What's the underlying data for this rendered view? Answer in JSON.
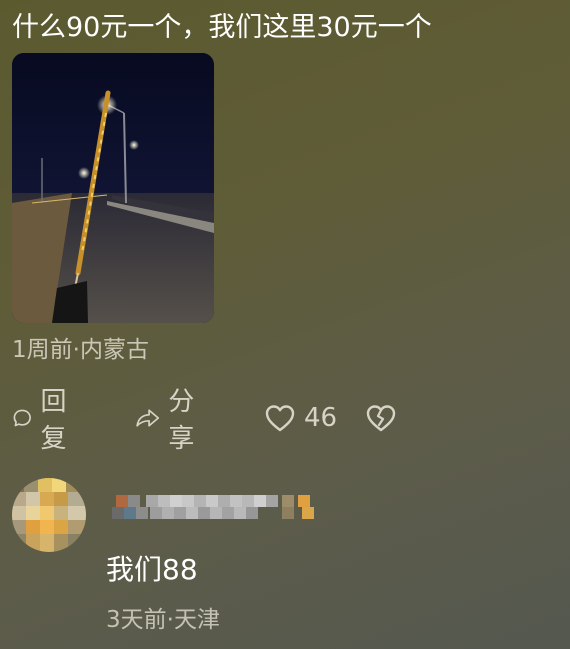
{
  "post": {
    "text": "什么90元一个，我们这里30元一个",
    "meta": "1周前·内蒙古"
  },
  "actions": {
    "reply_label": "回复",
    "share_label": "分享",
    "like_count": "46"
  },
  "reply": {
    "text": "我们88",
    "meta": "3天前·天津"
  },
  "icons": [
    "comment-icon",
    "share-icon",
    "heart-icon",
    "broken-heart-icon"
  ],
  "colors": {
    "background": "#5d5c40",
    "text_primary": "#ffffff",
    "text_secondary": "#c9c7b6",
    "icon": "#d6d4c6"
  }
}
